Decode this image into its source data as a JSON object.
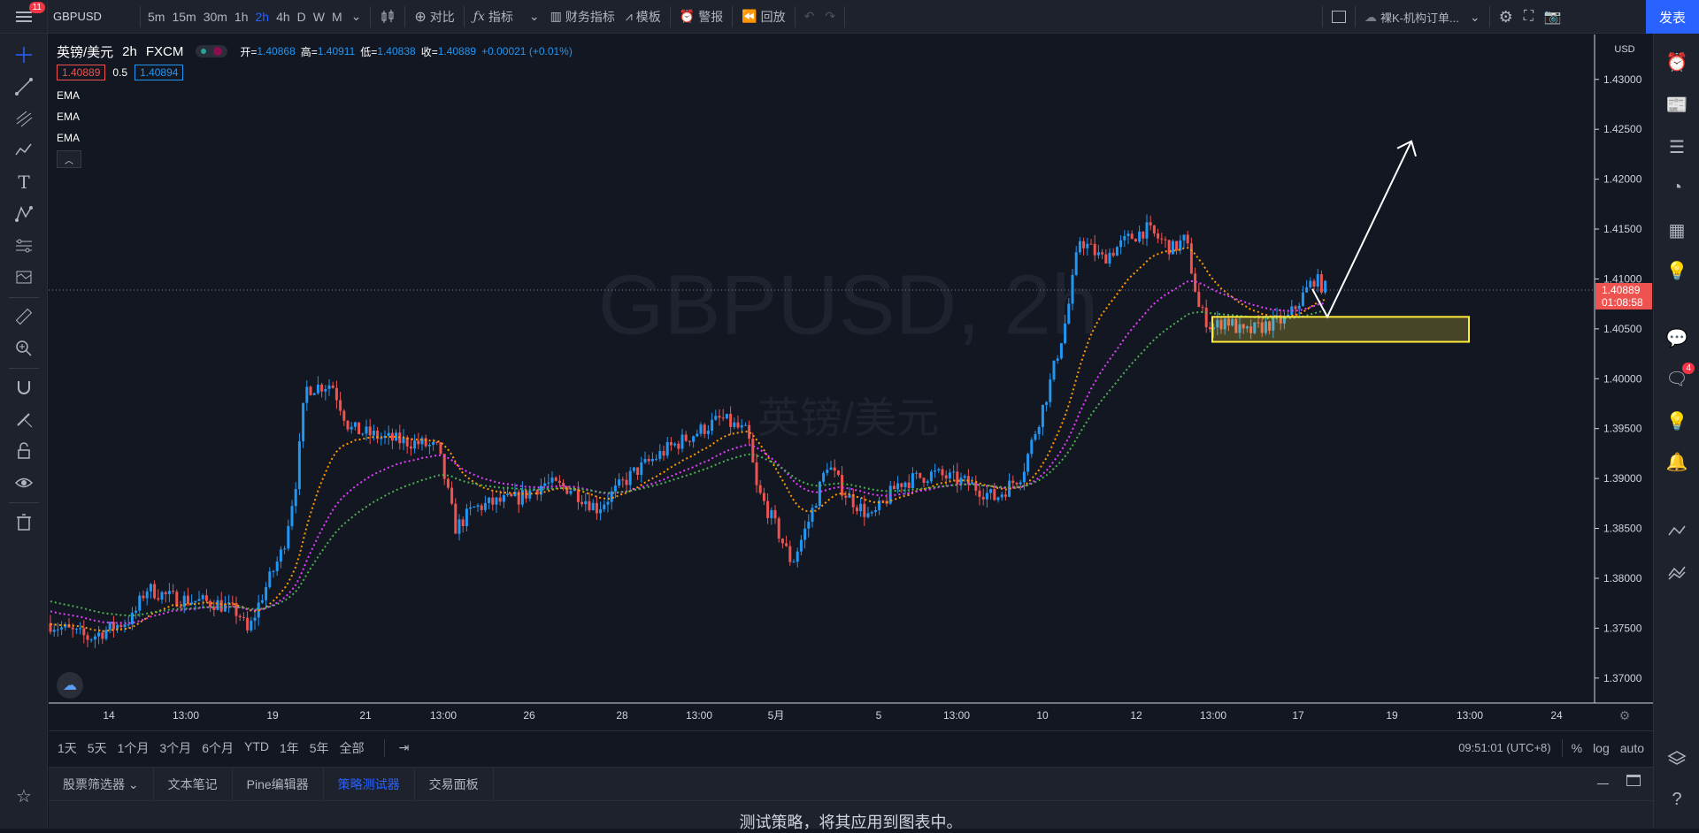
{
  "topbar": {
    "notification_count": "11",
    "symbol": "GBPUSD",
    "intervals": [
      "5m",
      "15m",
      "30m",
      "1h",
      "2h",
      "4h",
      "D",
      "W",
      "M"
    ],
    "active_interval": "2h",
    "compare_label": "对比",
    "indicators_label": "指标",
    "financials_label": "财务指标",
    "templates_label": "模板",
    "alert_label": "警报",
    "replay_label": "回放",
    "layout_name": "裸K-机构订单...",
    "publish_label": "发表"
  },
  "legend": {
    "symbol_name": "英镑/美元",
    "interval": "2h",
    "exchange": "FXCM",
    "open_label": "开=",
    "open": "1.40868",
    "high_label": "高=",
    "high": "1.40911",
    "low_label": "低=",
    "low": "1.40838",
    "close_label": "收=",
    "close": "1.40889",
    "change": "+0.00021 (+0.01%)",
    "bid": "1.40889",
    "spread": "0.5",
    "ask": "1.40894",
    "indicators": [
      "EMA",
      "EMA",
      "EMA"
    ]
  },
  "watermark": {
    "title": "GBPUSD, 2h",
    "subtitle": "英镑/美元"
  },
  "price_axis": {
    "currency": "USD",
    "labels": [
      "1.43000",
      "1.42500",
      "1.42000",
      "1.41500",
      "1.41000",
      "1.40500",
      "1.40000",
      "1.39500",
      "1.39000",
      "1.38500",
      "1.38000",
      "1.37500",
      "1.37000"
    ],
    "last_price": "1.40889",
    "countdown": "01:08:58"
  },
  "time_axis": {
    "labels": [
      "14",
      "13:00",
      "19",
      "21",
      "13:00",
      "26",
      "28",
      "13:00",
      "5月",
      "5",
      "13:00",
      "10",
      "12",
      "13:00",
      "17",
      "19",
      "13:00",
      "24"
    ]
  },
  "range_bar": {
    "ranges": [
      "1天",
      "5天",
      "1个月",
      "3个月",
      "6个月",
      "YTD",
      "1年",
      "5年",
      "全部"
    ],
    "clock": "09:51:01 (UTC+8)",
    "percent": "%",
    "log": "log",
    "auto": "auto"
  },
  "bottom_panel": {
    "tabs": [
      "股票筛选器",
      "文本笔记",
      "Pine编辑器",
      "策略测试器",
      "交易面板"
    ],
    "active_tab": "策略测试器",
    "message": "测试策略，将其应用到图表中。"
  },
  "right_badge": "4",
  "colors": {
    "up": "#2196f3",
    "down": "#ef5350",
    "ema_fast": "#ff9800",
    "ema_mid": "#e040fb",
    "ema_slow": "#4caf50",
    "zone": "#ffeb3b",
    "accent": "#2962ff"
  },
  "chart_data": {
    "type": "candlestick",
    "symbol": "GBPUSD",
    "interval": "2h",
    "ylim": [
      1.3675,
      1.4345
    ],
    "last_close": 1.40889,
    "zone": {
      "low": 1.4037,
      "high": 1.4062
    },
    "projection_target": 1.4238
  }
}
